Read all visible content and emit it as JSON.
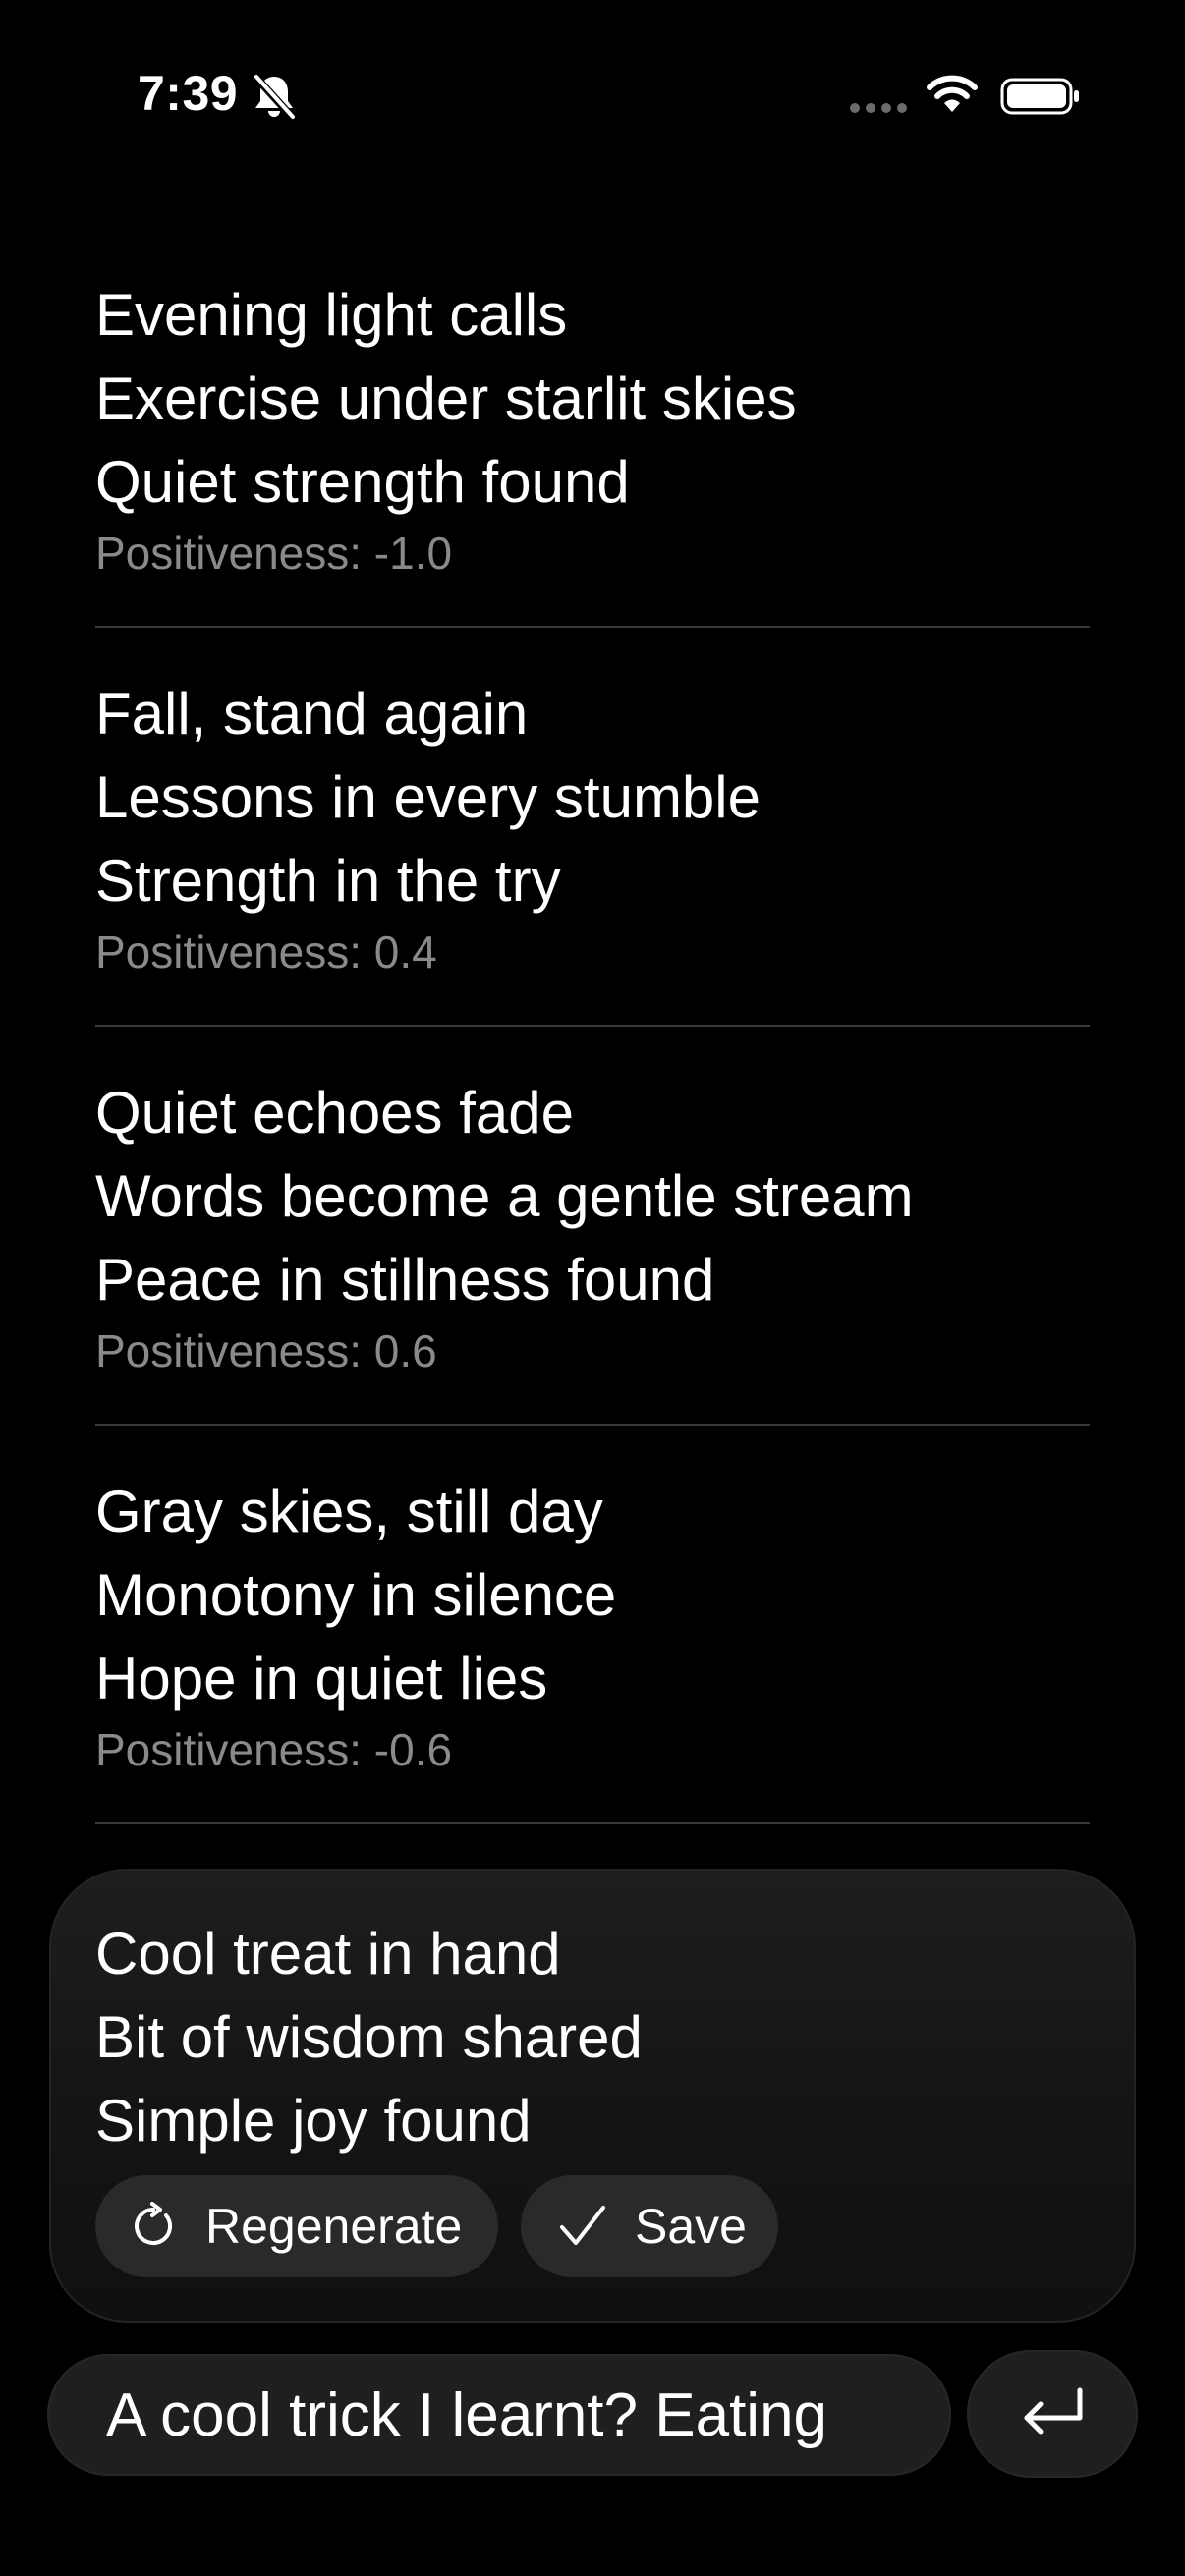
{
  "status_bar": {
    "time": "7:39"
  },
  "feed": {
    "items": [
      {
        "lines": [
          "Evening light calls",
          "Exercise under starlit skies",
          "Quiet strength found"
        ],
        "score": "Positiveness: -1.0"
      },
      {
        "lines": [
          "Fall, stand again",
          "Lessons in every stumble",
          "Strength in the try"
        ],
        "score": "Positiveness: 0.4"
      },
      {
        "lines": [
          "Quiet echoes fade",
          "Words become a gentle stream",
          "Peace in stillness found"
        ],
        "score": "Positiveness: 0.6"
      },
      {
        "lines": [
          "Gray skies, still day",
          "Monotony in silence",
          "Hope in quiet lies"
        ],
        "score": "Positiveness: -0.6"
      }
    ]
  },
  "draft": {
    "lines": [
      "Cool treat in hand",
      "Bit of wisdom shared",
      "Simple joy found"
    ],
    "regenerate_label": "Regenerate",
    "save_label": "Save"
  },
  "composer": {
    "value": "A cool trick I learnt? Eating"
  },
  "colors": {
    "background": "#000000",
    "text": "#ffffff",
    "secondary_text": "#8a8a8e",
    "divider": "#3a3a3c",
    "pill": "#2a2a2a"
  },
  "icons": [
    "bell-slash-icon",
    "cellular-dots-icon",
    "wifi-icon",
    "battery-icon",
    "regenerate-icon",
    "checkmark-icon",
    "return-icon"
  ]
}
